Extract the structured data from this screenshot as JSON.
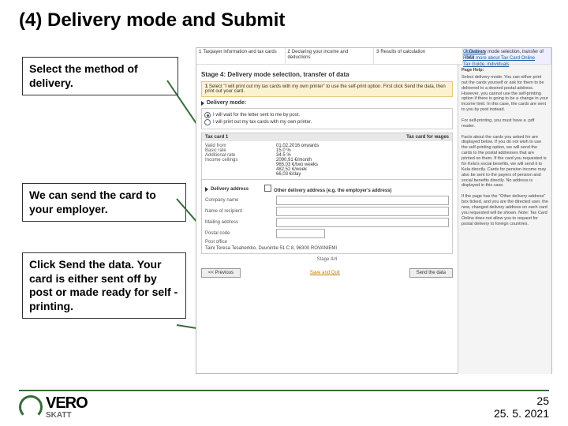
{
  "title": "(4) Delivery mode and Submit",
  "callouts": {
    "c1": "Select the method of delivery.",
    "c2": "We can send the card to your employer.",
    "c3": "Click Send the data. Your card is either sent off by post or made ready for self -printing."
  },
  "steps": {
    "s1": {
      "n": "1",
      "t": "Taxpayer information and tax cards"
    },
    "s2": {
      "n": "2",
      "t": "Declaring your income and deductions"
    },
    "s3": {
      "n": "3",
      "t": "Results of calculation"
    },
    "s4": {
      "n": "4",
      "t": "Delivery mode selection, transfer of data"
    }
  },
  "links": {
    "a": "Contact us",
    "b": "Read more about Tax Card Online",
    "c": "Tax Guide, individuals"
  },
  "stage_title": "Stage 4: Delivery mode selection, transfer of data",
  "hint": {
    "n": "1",
    "t": "Select \"I will print out my tax cards with my own printer\" to use the self-print option. First click Send the data, then print out your card."
  },
  "delivery": {
    "label": "Delivery mode:",
    "opt1": "I will wait for the letter sent to me by post.",
    "opt2": "I will print out my tax cards with my own printer."
  },
  "card": {
    "head": "Tax card 1",
    "type": "Tax card for wages",
    "rows": {
      "valid_l": "Valid from",
      "valid_v": "01.02.2016 onwards",
      "rate_l": "Basic rate",
      "rate_v": "15.0 %",
      "add_l": "Additional rate",
      "add_v": "34.5 %",
      "inc_l": "Income ceilings",
      "inc_v1": "2090,91  €/month",
      "inc_v2": "965,03  €/two weeks",
      "inc_v3": "482,52  €/week",
      "inc_v4": "66,03  €/day"
    }
  },
  "addr": {
    "label": "Delivery address",
    "chk": "Other delivery address (e.g. the employer's address)",
    "f1": "Company name",
    "f2": "Name of recipient",
    "f3": "Mailing address",
    "f4": "Postal code",
    "f5": "Post office",
    "po": "Taini Teresa Tesaherkko, Duunintie 51 C 8, 96300 ROVANIEMI"
  },
  "stage_ind": "Stage 4/4",
  "nav": {
    "prev": "<< Previous",
    "save": "Save and Quit",
    "send": "Send the data"
  },
  "side": {
    "h": "Page Help:",
    "p1": "Select delivery mode. You can either print out the cards yourself or ask for them to be delivered to a desired postal address. However, you cannot use the self-printing option if there is going to be a change in your income limit. In this case, the cards are sent to you by post instead.",
    "p2": "For self-printing, you must have a .pdf reader.",
    "p3": "Facts about the cards you asked for are displayed below. If you do not wish to use the self-printing option, we will send the cards to the postal addresses that are printed on them. If the card you requested is for Kela's social benefits, we will send it to Kela directly. Cards for pension income may also be sent to the payers of pension and social benefits directly. No address is displayed in this case.",
    "p4": "If the page has the \"Other delivery address\" box ticked, and you are the directed user, the new, changed delivery address on each card you requested will be shown. Note: Tax Card Online does not allow you to request for postal delivery to foreign countries."
  },
  "logo": {
    "top": "VERO",
    "bot": "SKATT"
  },
  "page": "25",
  "date": "25. 5. 2021"
}
